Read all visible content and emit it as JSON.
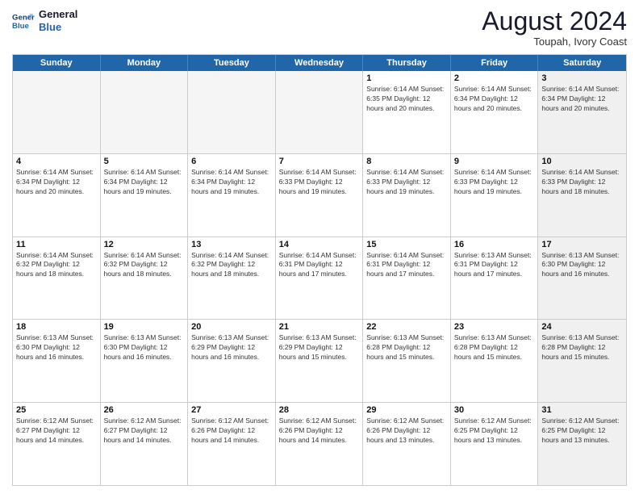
{
  "header": {
    "logo_line1": "General",
    "logo_line2": "Blue",
    "month_title": "August 2024",
    "location": "Toupah, Ivory Coast"
  },
  "day_headers": [
    "Sunday",
    "Monday",
    "Tuesday",
    "Wednesday",
    "Thursday",
    "Friday",
    "Saturday"
  ],
  "weeks": [
    [
      {
        "day": "",
        "info": "",
        "empty": true
      },
      {
        "day": "",
        "info": "",
        "empty": true
      },
      {
        "day": "",
        "info": "",
        "empty": true
      },
      {
        "day": "",
        "info": "",
        "empty": true
      },
      {
        "day": "1",
        "info": "Sunrise: 6:14 AM\nSunset: 6:35 PM\nDaylight: 12 hours\nand 20 minutes.",
        "empty": false
      },
      {
        "day": "2",
        "info": "Sunrise: 6:14 AM\nSunset: 6:34 PM\nDaylight: 12 hours\nand 20 minutes.",
        "empty": false
      },
      {
        "day": "3",
        "info": "Sunrise: 6:14 AM\nSunset: 6:34 PM\nDaylight: 12 hours\nand 20 minutes.",
        "empty": false,
        "shaded": true
      }
    ],
    [
      {
        "day": "4",
        "info": "Sunrise: 6:14 AM\nSunset: 6:34 PM\nDaylight: 12 hours\nand 20 minutes.",
        "empty": false
      },
      {
        "day": "5",
        "info": "Sunrise: 6:14 AM\nSunset: 6:34 PM\nDaylight: 12 hours\nand 19 minutes.",
        "empty": false
      },
      {
        "day": "6",
        "info": "Sunrise: 6:14 AM\nSunset: 6:34 PM\nDaylight: 12 hours\nand 19 minutes.",
        "empty": false
      },
      {
        "day": "7",
        "info": "Sunrise: 6:14 AM\nSunset: 6:33 PM\nDaylight: 12 hours\nand 19 minutes.",
        "empty": false
      },
      {
        "day": "8",
        "info": "Sunrise: 6:14 AM\nSunset: 6:33 PM\nDaylight: 12 hours\nand 19 minutes.",
        "empty": false
      },
      {
        "day": "9",
        "info": "Sunrise: 6:14 AM\nSunset: 6:33 PM\nDaylight: 12 hours\nand 19 minutes.",
        "empty": false
      },
      {
        "day": "10",
        "info": "Sunrise: 6:14 AM\nSunset: 6:33 PM\nDaylight: 12 hours\nand 18 minutes.",
        "empty": false,
        "shaded": true
      }
    ],
    [
      {
        "day": "11",
        "info": "Sunrise: 6:14 AM\nSunset: 6:32 PM\nDaylight: 12 hours\nand 18 minutes.",
        "empty": false
      },
      {
        "day": "12",
        "info": "Sunrise: 6:14 AM\nSunset: 6:32 PM\nDaylight: 12 hours\nand 18 minutes.",
        "empty": false
      },
      {
        "day": "13",
        "info": "Sunrise: 6:14 AM\nSunset: 6:32 PM\nDaylight: 12 hours\nand 18 minutes.",
        "empty": false
      },
      {
        "day": "14",
        "info": "Sunrise: 6:14 AM\nSunset: 6:31 PM\nDaylight: 12 hours\nand 17 minutes.",
        "empty": false
      },
      {
        "day": "15",
        "info": "Sunrise: 6:14 AM\nSunset: 6:31 PM\nDaylight: 12 hours\nand 17 minutes.",
        "empty": false
      },
      {
        "day": "16",
        "info": "Sunrise: 6:13 AM\nSunset: 6:31 PM\nDaylight: 12 hours\nand 17 minutes.",
        "empty": false
      },
      {
        "day": "17",
        "info": "Sunrise: 6:13 AM\nSunset: 6:30 PM\nDaylight: 12 hours\nand 16 minutes.",
        "empty": false,
        "shaded": true
      }
    ],
    [
      {
        "day": "18",
        "info": "Sunrise: 6:13 AM\nSunset: 6:30 PM\nDaylight: 12 hours\nand 16 minutes.",
        "empty": false
      },
      {
        "day": "19",
        "info": "Sunrise: 6:13 AM\nSunset: 6:30 PM\nDaylight: 12 hours\nand 16 minutes.",
        "empty": false
      },
      {
        "day": "20",
        "info": "Sunrise: 6:13 AM\nSunset: 6:29 PM\nDaylight: 12 hours\nand 16 minutes.",
        "empty": false
      },
      {
        "day": "21",
        "info": "Sunrise: 6:13 AM\nSunset: 6:29 PM\nDaylight: 12 hours\nand 15 minutes.",
        "empty": false
      },
      {
        "day": "22",
        "info": "Sunrise: 6:13 AM\nSunset: 6:28 PM\nDaylight: 12 hours\nand 15 minutes.",
        "empty": false
      },
      {
        "day": "23",
        "info": "Sunrise: 6:13 AM\nSunset: 6:28 PM\nDaylight: 12 hours\nand 15 minutes.",
        "empty": false
      },
      {
        "day": "24",
        "info": "Sunrise: 6:13 AM\nSunset: 6:28 PM\nDaylight: 12 hours\nand 15 minutes.",
        "empty": false,
        "shaded": true
      }
    ],
    [
      {
        "day": "25",
        "info": "Sunrise: 6:12 AM\nSunset: 6:27 PM\nDaylight: 12 hours\nand 14 minutes.",
        "empty": false
      },
      {
        "day": "26",
        "info": "Sunrise: 6:12 AM\nSunset: 6:27 PM\nDaylight: 12 hours\nand 14 minutes.",
        "empty": false
      },
      {
        "day": "27",
        "info": "Sunrise: 6:12 AM\nSunset: 6:26 PM\nDaylight: 12 hours\nand 14 minutes.",
        "empty": false
      },
      {
        "day": "28",
        "info": "Sunrise: 6:12 AM\nSunset: 6:26 PM\nDaylight: 12 hours\nand 14 minutes.",
        "empty": false
      },
      {
        "day": "29",
        "info": "Sunrise: 6:12 AM\nSunset: 6:26 PM\nDaylight: 12 hours\nand 13 minutes.",
        "empty": false
      },
      {
        "day": "30",
        "info": "Sunrise: 6:12 AM\nSunset: 6:25 PM\nDaylight: 12 hours\nand 13 minutes.",
        "empty": false
      },
      {
        "day": "31",
        "info": "Sunrise: 6:12 AM\nSunset: 6:25 PM\nDaylight: 12 hours\nand 13 minutes.",
        "empty": false,
        "shaded": true
      }
    ]
  ]
}
